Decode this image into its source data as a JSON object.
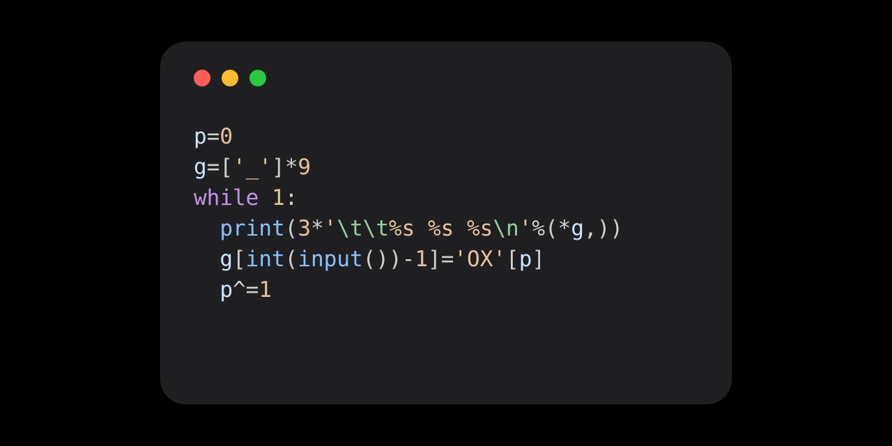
{
  "code": {
    "line1": {
      "var_p": "p",
      "eq": "=",
      "num0": "0"
    },
    "line2": {
      "var_g": "g",
      "eq": "=",
      "lbr": "[",
      "q1": "'",
      "us": "_",
      "q2": "'",
      "rbr": "]",
      "mul": "*",
      "num9": "9"
    },
    "line3": {
      "while": "while",
      "sp": " ",
      "num1": "1",
      "colon": ":"
    },
    "line4": {
      "indent": "  ",
      "print": "print",
      "lp": "(",
      "num3": "3",
      "mul": "*",
      "q1": "'",
      "t1": "\\t",
      "t2": "\\t",
      "s1": "%s",
      "sp1": " ",
      "s2": "%s",
      "sp2": " ",
      "s3": "%s",
      "nl": "\\n",
      "q2": "'",
      "pct": "%",
      "lp2": "(",
      "star": "*",
      "g": "g",
      "comma": ",",
      "rp2": ")",
      "rp": ")"
    },
    "line5": {
      "indent": "  ",
      "g": "g",
      "lbr": "[",
      "int": "int",
      "lp": "(",
      "input": "input",
      "lp2": "(",
      "rp2": ")",
      "rp": ")",
      "minus": "-",
      "num1": "1",
      "rbr": "]",
      "eq": "=",
      "q1": "'",
      "ox": "OX",
      "q2": "'",
      "lbr2": "[",
      "p": "p",
      "rbr2": "]"
    },
    "line6": {
      "indent": "  ",
      "p": "p",
      "xor": "^=",
      "num1": "1"
    }
  }
}
